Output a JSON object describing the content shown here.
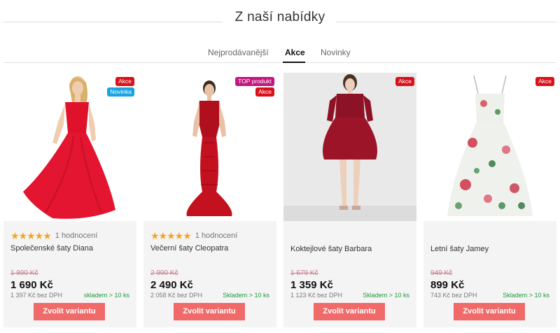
{
  "heading": "Z naší nabídky",
  "tabs": [
    {
      "label": "Nejprodávanější",
      "active": false
    },
    {
      "label": "Akce",
      "active": true
    },
    {
      "label": "Novinky",
      "active": false
    }
  ],
  "colors": {
    "sale_badge": "#d8111a",
    "new_badge": "#1aa3e0",
    "top_badge": "#c2177e",
    "button": "#f06a6a",
    "stock": "#1e9a3c",
    "stars": "#f1a525"
  },
  "products": [
    {
      "name": "Společenské šaty Diana",
      "badges": [
        "Akce",
        "Novinka"
      ],
      "stars": "★★★★★",
      "rating_text": "1 hodnocení",
      "old_price": "1 890 Kč",
      "price": "1 690 Kč",
      "net_price": "1 397 Kč bez DPH",
      "stock": "skladem > 10 ks",
      "button": "Zvolit variantu",
      "image": "red-flowing-gown"
    },
    {
      "name": "Večerní šaty Cleopatra",
      "badges": [
        "TOP produkt",
        "Akce"
      ],
      "stars": "★★★★★",
      "rating_text": "1 hodnocení",
      "old_price": "2 990 Kč",
      "price": "2 490 Kč",
      "net_price": "2 058 Kč bez DPH",
      "stock": "Skladem > 10 ks",
      "button": "Zvolit variantu",
      "image": "red-sequin-mermaid-gown"
    },
    {
      "name": "Koktejlové šaty Barbara",
      "badges": [
        "Akce"
      ],
      "old_price": "1 679 Kč",
      "price": "1 359 Kč",
      "net_price": "1 123 Kč bez DPH",
      "stock": "Skladem > 10 ks",
      "button": "Zvolit variantu",
      "image": "burgundy-cocktail-dress"
    },
    {
      "name": "Letní šaty Jamey",
      "badges": [
        "Akce"
      ],
      "old_price": "949 Kč",
      "price": "899 Kč",
      "net_price": "743 Kč bez DPH",
      "stock": "Skladem > 10 ks",
      "button": "Zvolit variantu",
      "image": "floral-summer-dress"
    }
  ]
}
